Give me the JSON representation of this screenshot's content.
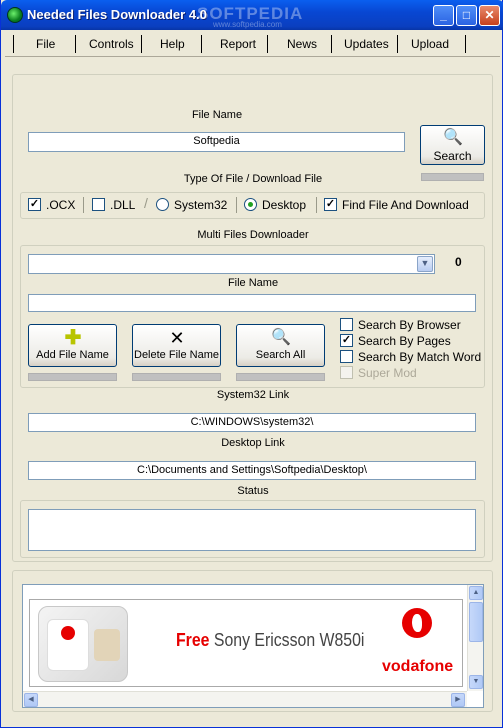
{
  "window": {
    "title": "Needed Files Downloader 4.0",
    "watermark": "SOFTPEDIA",
    "watermark_sub": "www.softpedia.com",
    "controls": {
      "minimize": "_",
      "maximize": "□",
      "close": "✕"
    }
  },
  "menu": [
    "File",
    "Controls",
    "Help",
    "Report",
    "News",
    "Updates",
    "Upload"
  ],
  "search_section": {
    "file_name_label": "File Name",
    "file_name_value": "Softpedia",
    "search_button": "Search"
  },
  "type_section": {
    "label": "Type Of File / Download File",
    "options": [
      {
        "label": ".OCX",
        "kind": "checkbox",
        "checked": true
      },
      {
        "label": ".DLL",
        "kind": "checkbox",
        "checked": false
      },
      {
        "label": "System32",
        "kind": "radio",
        "checked": false
      },
      {
        "label": "Desktop",
        "kind": "radio",
        "checked": true
      },
      {
        "label": "Find File And Download",
        "kind": "checkbox",
        "checked": true
      }
    ]
  },
  "multi_section": {
    "label": "Multi Files Downloader",
    "dropdown_value": "",
    "count": "0",
    "file_name_label": "File Name",
    "file_name_value": "",
    "add_button": "Add File Name",
    "delete_button": "Delete File Name",
    "search_all_button": "Search All",
    "options": [
      {
        "label": "Search By Browser",
        "checked": false,
        "enabled": true
      },
      {
        "label": "Search By Pages",
        "checked": true,
        "enabled": true
      },
      {
        "label": "Search By Match Word",
        "checked": false,
        "enabled": true
      },
      {
        "label": "Super Mod",
        "checked": false,
        "enabled": false
      }
    ]
  },
  "paths": {
    "system32_label": "System32 Link",
    "system32_value": "C:\\WINDOWS\\system32\\",
    "desktop_label": "Desktop Link",
    "desktop_value": "C:\\Documents and Settings\\Softpedia\\Desktop\\",
    "status_label": "Status",
    "status_value": ""
  },
  "ad": {
    "free": "Free",
    "product": "Sony Ericsson W850i",
    "brand": "vodafone",
    "colors": {
      "brand": "#E60000"
    }
  },
  "icons": {
    "search": "search-icon",
    "add": "plus-icon",
    "delete": "x-icon",
    "search_all": "search-icon"
  }
}
